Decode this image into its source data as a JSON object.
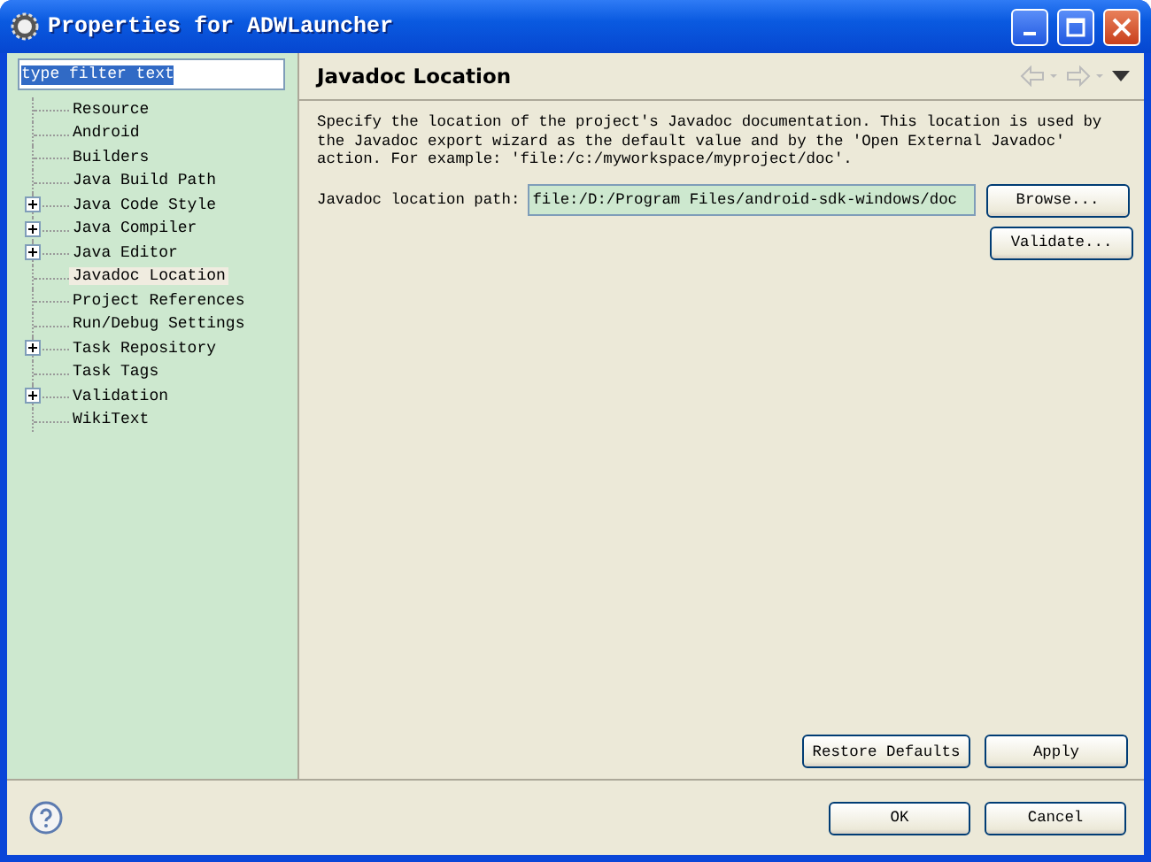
{
  "window": {
    "title": "Properties for ADWLauncher"
  },
  "filter": {
    "value": "type filter text"
  },
  "tree": [
    {
      "label": "Resource",
      "kind": "leaf",
      "selected": false
    },
    {
      "label": "Android",
      "kind": "leaf",
      "selected": false
    },
    {
      "label": "Builders",
      "kind": "leaf",
      "selected": false
    },
    {
      "label": "Java Build Path",
      "kind": "leaf",
      "selected": false
    },
    {
      "label": "Java Code Style",
      "kind": "folder",
      "selected": false
    },
    {
      "label": "Java Compiler",
      "kind": "folder",
      "selected": false
    },
    {
      "label": "Java Editor",
      "kind": "folder",
      "selected": false
    },
    {
      "label": "Javadoc Location",
      "kind": "leaf",
      "selected": true
    },
    {
      "label": "Project References",
      "kind": "leaf",
      "selected": false
    },
    {
      "label": "Run/Debug Settings",
      "kind": "leaf",
      "selected": false
    },
    {
      "label": "Task Repository",
      "kind": "folder",
      "selected": false
    },
    {
      "label": "Task Tags",
      "kind": "leaf",
      "selected": false
    },
    {
      "label": "Validation",
      "kind": "folder",
      "selected": false
    },
    {
      "label": "WikiText",
      "kind": "leaf",
      "selected": false
    }
  ],
  "page": {
    "title": "Javadoc Location",
    "description": "Specify the location of the project's Javadoc documentation. This location is used by the Javadoc export wizard as the default value and by the 'Open External Javadoc' action. For example: 'file:/c:/myworkspace/myproject/doc'.",
    "path_label": "Javadoc location path:",
    "path_value": "file:/D:/Program Files/android-sdk-windows/doc",
    "side_buttons": [
      "Browse...",
      "Validate..."
    ],
    "bottom_buttons": [
      "Restore Defaults",
      "Apply"
    ]
  },
  "footer_buttons": [
    "OK",
    "Cancel"
  ]
}
